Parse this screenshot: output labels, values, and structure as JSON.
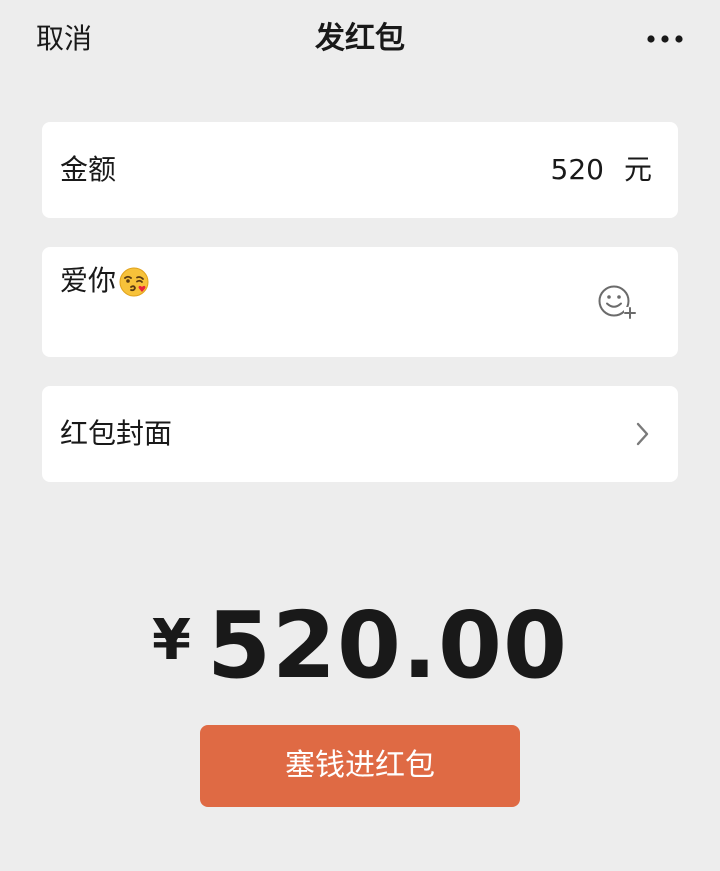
{
  "header": {
    "cancel_label": "取消",
    "title": "发红包",
    "more_icon": "more-dots-icon"
  },
  "amount_card": {
    "label": "金额",
    "value": "520",
    "unit": "元"
  },
  "message_card": {
    "text": "爱你",
    "emoji": "kissing-face-emoji",
    "emoji_button_icon": "emoji-add-icon"
  },
  "cover_card": {
    "label": "红包封面",
    "chevron_icon": "chevron-right-icon"
  },
  "total": {
    "currency": "¥",
    "value": "520.00"
  },
  "send_button": {
    "label": "塞钱进红包"
  },
  "colors": {
    "background": "#ededed",
    "card": "#ffffff",
    "button": "#df6a44",
    "text": "#191919"
  }
}
